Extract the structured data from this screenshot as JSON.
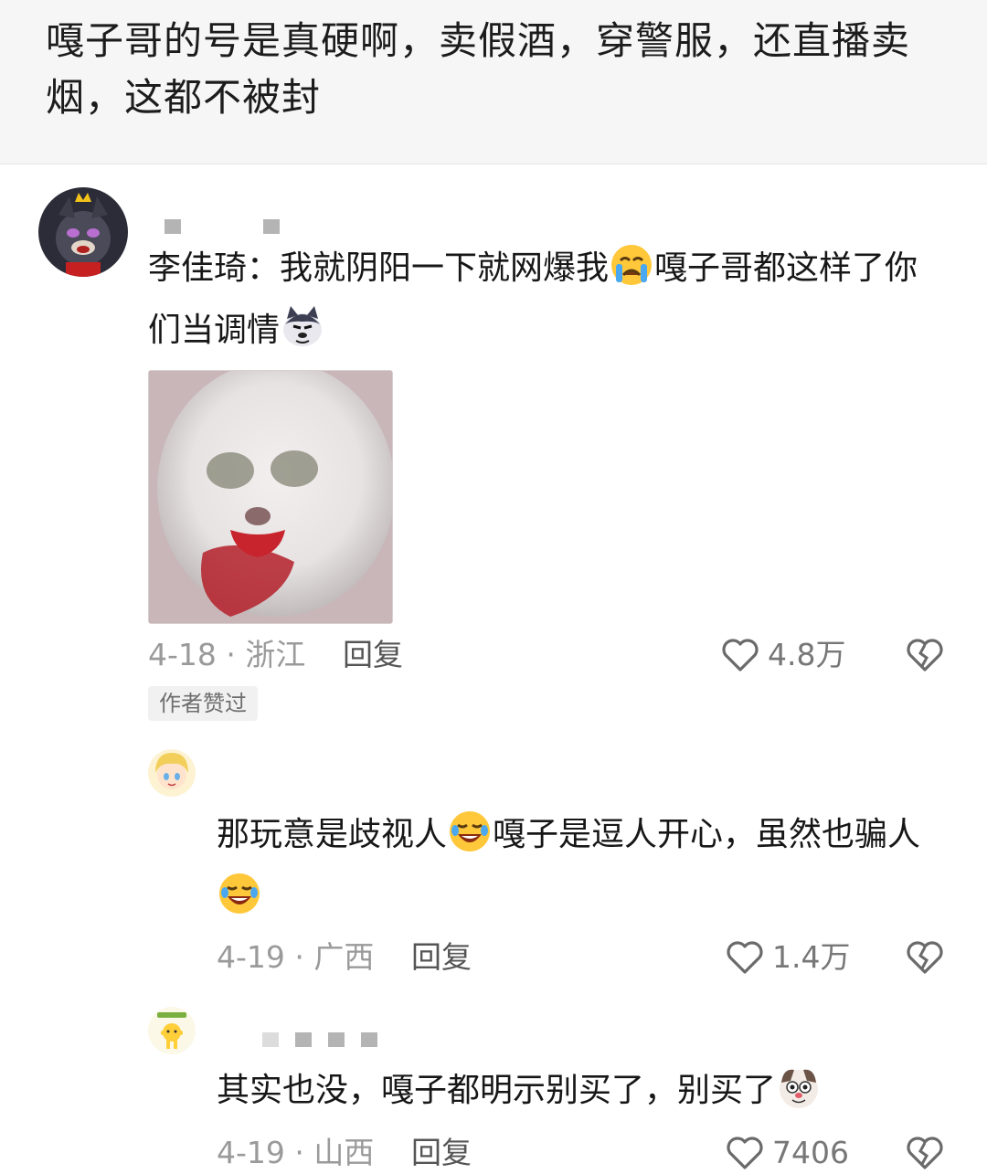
{
  "post": {
    "title": "嘎子哥的号是真硬啊，卖假酒，穿警服，还直播卖烟，这都不被封"
  },
  "comments": [
    {
      "text_before": "李佳琦：我就阴阳一下就网爆我",
      "emoji_mid": "crying-emoji",
      "text_after": "嘎子哥都这样了你们当调情",
      "emoji_end": "husky-emoji",
      "date_location": "4-18 · 浙江",
      "reply_label": "回复",
      "likes": "4.8万",
      "badge": "作者赞过"
    },
    {
      "text_before": "那玩意是歧视人",
      "emoji_mid": "rofl-emoji",
      "text_after": "嘎子是逗人开心，虽然也骗人",
      "emoji_end": "rofl-emoji",
      "date_location": "4-19 · 广西",
      "reply_label": "回复",
      "likes": "1.4万"
    },
    {
      "text_before": "其实也没，嘎子都明示别买了，别买了",
      "emoji_end": "dog-emoji",
      "date_location": "4-19 · 山西",
      "reply_label": "回复",
      "likes": "7406"
    }
  ],
  "colors": {
    "header_bg": "#f6f6f6",
    "meta_text": "#9a9a9a",
    "badge_bg": "#f1f1f1"
  }
}
